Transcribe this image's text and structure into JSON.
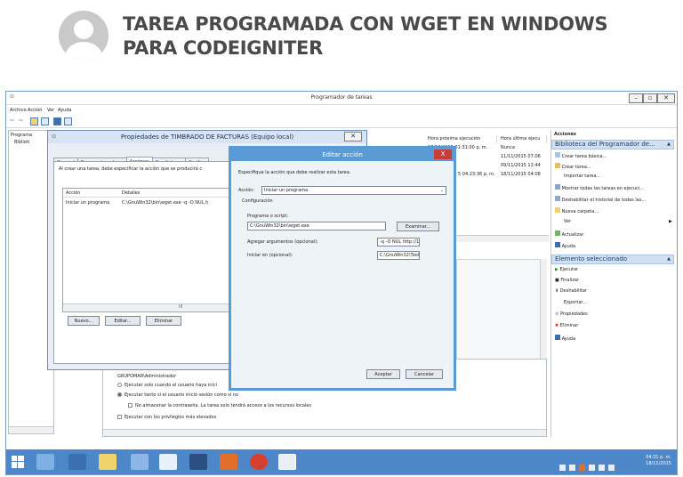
{
  "post": {
    "title_line1": "TAREA PROGRAMADA CON WGET EN WINDOWS",
    "title_line2": "PARA CODEIGNITER"
  },
  "window": {
    "title": "Programador de tareas",
    "menu": [
      "Archivo",
      "Acción",
      "Ver",
      "Ayuda"
    ],
    "tree": [
      "Programa",
      "Biblioti"
    ]
  },
  "properties_dialog": {
    "title": "Propiedades de TIMBRADO DE FACTURAS (Equipo local)",
    "tabs": [
      "General",
      "Desencadenadores",
      "Acciones",
      "Condiciones",
      "Configu"
    ],
    "active_tab": "Acciones",
    "intro": "Al crear una tarea, debe especificar la acción que se producirá c",
    "columns": [
      "Acción",
      "Detalles"
    ],
    "rows": [
      [
        "Iniciar un programa",
        "C:\\GnuWin32\\bin\\wget.exe -q -O NUL h"
      ]
    ],
    "scroll_mark": "III",
    "buttons": [
      "Nuevo...",
      "Editar...",
      "Eliminar"
    ]
  },
  "edit_dialog": {
    "title": "Editar acción",
    "close": "X",
    "intro": "Especifique la acción que debe realizar esta tarea.",
    "action_label": "Acción:",
    "action_value": "Iniciar un programa",
    "config_label": "Configuración",
    "program_label": "Programa o script:",
    "program_value": "C:\\GnuWin32\\bin\\wget.exe",
    "browse": "Examinar...",
    "args_label": "Agregar argumentos (opcional):",
    "args_value": "-q -O NUL http://127.0.0",
    "start_label": "Iniciar en (opcional):",
    "start_value": "C:\\GnuWin32\\Tools\\gnu",
    "ok": "Aceptar",
    "cancel": "Cancelar"
  },
  "task_list": {
    "columns": [
      "Hora próxima ejecución",
      "Hora última ejecu"
    ],
    "rows": [
      [
        "07/12/2015 01:31:00 p. m.",
        "Nunca"
      ],
      [
        "",
        "11/11/2015 07:06"
      ],
      [
        "",
        "09/11/2015 12:44"
      ],
      [
        "5 04:23:36 p. m.",
        "18/11/2015 04:08"
      ]
    ]
  },
  "security": {
    "user": "GRUPOMAR\\Administrador",
    "option1": "Ejecutar solo cuando el usuario haya inici",
    "option2": "Ejecutar tanto si el usuario inició sesión como si no",
    "option3": "No almacenar la contraseña. La tarea solo tendrá acceso a los recursos locales",
    "option4": "Ejecutar con los privilegios más elevados"
  },
  "actions_pane": {
    "header": "Acciones",
    "section1": "Biblioteca del Programador de...",
    "items1": [
      "Crear tarea básica...",
      "Crear tarea...",
      "Importar tarea...",
      "Mostrar todas las tareas en ejecuci...",
      "Deshabilitar el historial de todas las...",
      "Nueva carpeta...",
      "Ver",
      "Actualizar",
      "Ayuda"
    ],
    "section2": "Elemento seleccionado",
    "items2": [
      "Ejecutar",
      "Finalizar",
      "Deshabilitar",
      "Exportar...",
      "Propiedades",
      "Eliminar",
      "Ayuda"
    ]
  },
  "taskbar": {
    "time": "04:31 p. m.",
    "date": "18/11/2015"
  },
  "colors": {
    "accent": "#5b9bd5",
    "taskbar": "#4d86c9",
    "title_text": "#4a4a4a"
  }
}
